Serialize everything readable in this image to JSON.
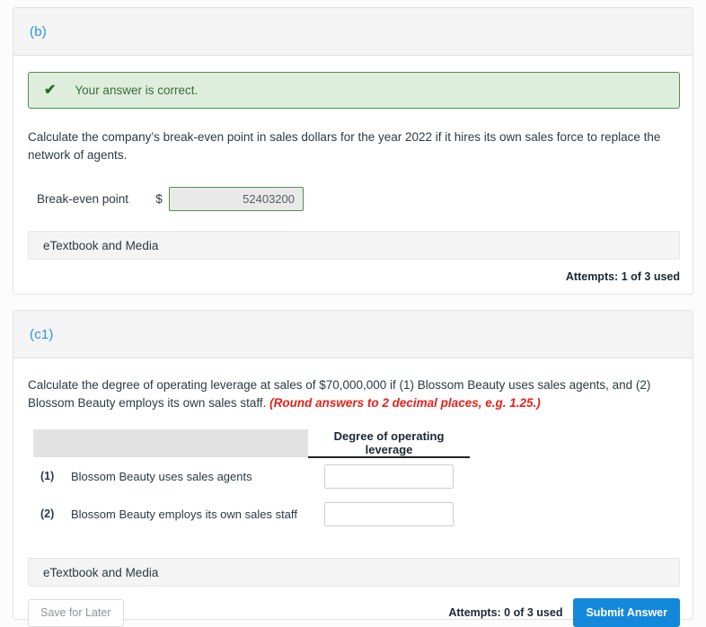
{
  "parts": [
    {
      "id": "b",
      "label": "(b)",
      "alert": {
        "icon": "check-icon",
        "glyph": "✔",
        "message": "Your answer is correct.",
        "color": "#4f8f4f",
        "background": "#ddeedd"
      },
      "question": "Calculate the company’s break-even point in sales dollars for the year 2022 if it hires its own sales force to replace the network of agents.",
      "answer": {
        "label": "Break-even point",
        "currency": "$",
        "value": "52403200",
        "state": "correct",
        "border_color": "#4f8f4f"
      },
      "etextbook_label": "eTextbook and Media",
      "attempts": "Attempts: 1 of 3 used"
    },
    {
      "id": "c1",
      "label": "(c1)",
      "question_main": "Calculate the degree of operating leverage at sales of $70,000,000 if (1) Blossom Beauty uses sales agents, and (2) Blossom Beauty employs its own sales staff.",
      "question_note": "(Round answers to 2 decimal places, e.g. 1.25.)",
      "note_color": "#e8201a",
      "table": {
        "headers": [
          "",
          "Degree of operating leverage"
        ],
        "rows": [
          {
            "index": "(1)",
            "description": "Blossom Beauty uses sales agents",
            "value": "",
            "placeholder": ""
          },
          {
            "index": "(2)",
            "description": "Blossom Beauty employs its own sales staff",
            "value": "",
            "placeholder": ""
          }
        ]
      },
      "etextbook_label": "eTextbook and Media",
      "attempts": "Attempts: 0 of 3 used",
      "buttons": {
        "save": "Save for Later",
        "submit": "Submit Answer",
        "submit_color": "#1388db"
      }
    }
  ]
}
